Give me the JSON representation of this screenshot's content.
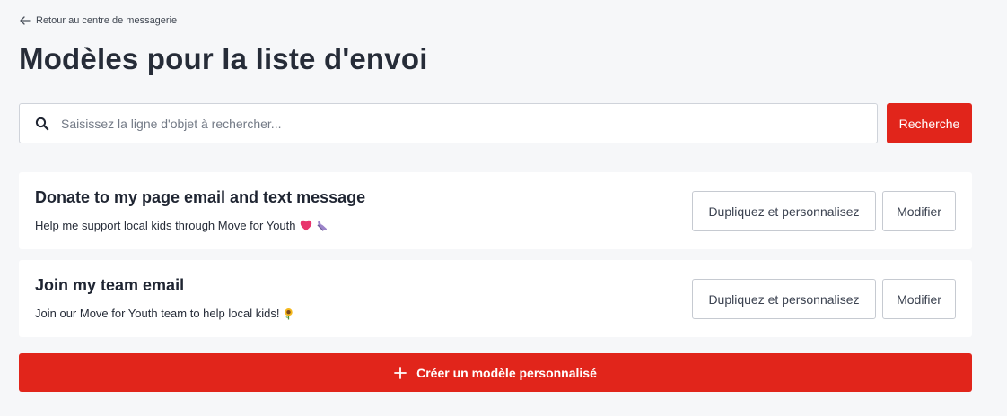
{
  "header": {
    "back_link": "Retour au centre de messagerie",
    "title": "Modèles pour la liste d'envoi"
  },
  "search": {
    "placeholder": "Saisissez la ligne d'objet à rechercher...",
    "value": "",
    "button_label": "Recherche"
  },
  "templates": [
    {
      "title": "Donate to my page email and text message",
      "description": "Help me support local kids through Move for Youth",
      "emojis": [
        "heart-icon",
        "sneaker-icon"
      ],
      "duplicate_label": "Dupliquez et personnalisez",
      "edit_label": "Modifier"
    },
    {
      "title": "Join my team email",
      "description": "Join our Move for Youth team to help local kids!",
      "emojis": [
        "sunflower-icon"
      ],
      "duplicate_label": "Dupliquez et personnalisez",
      "edit_label": "Modifier"
    }
  ],
  "create_button": {
    "label": "Créer un modèle personnalisé"
  },
  "colors": {
    "accent": "#e1251b",
    "background": "#f6f7f9",
    "card": "#ffffff",
    "text": "#1f2532"
  }
}
